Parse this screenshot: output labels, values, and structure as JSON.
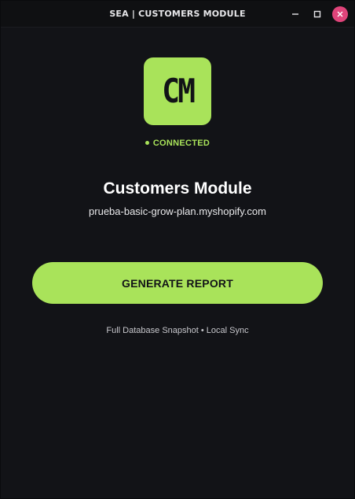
{
  "window": {
    "title": "SEA | CUSTOMERS MODULE",
    "controls": {
      "minimize": "minimize-icon",
      "maximize": "maximize-icon",
      "close": "close-icon"
    }
  },
  "logo": {
    "text": "CM",
    "color": "#a9e35a"
  },
  "status": {
    "dot": "•",
    "label": "CONNECTED",
    "color": "#a9e35a"
  },
  "main": {
    "title": "Customers Module",
    "store": "prueba-basic-grow-plan.myshopify.com"
  },
  "actions": {
    "generate_label": "GENERATE REPORT"
  },
  "footer": {
    "note": "Full Database Snapshot • Local Sync"
  },
  "colors": {
    "background": "#121317",
    "titlebar": "#0f1012",
    "accent": "#a9e35a",
    "close_button": "#e0447a"
  }
}
